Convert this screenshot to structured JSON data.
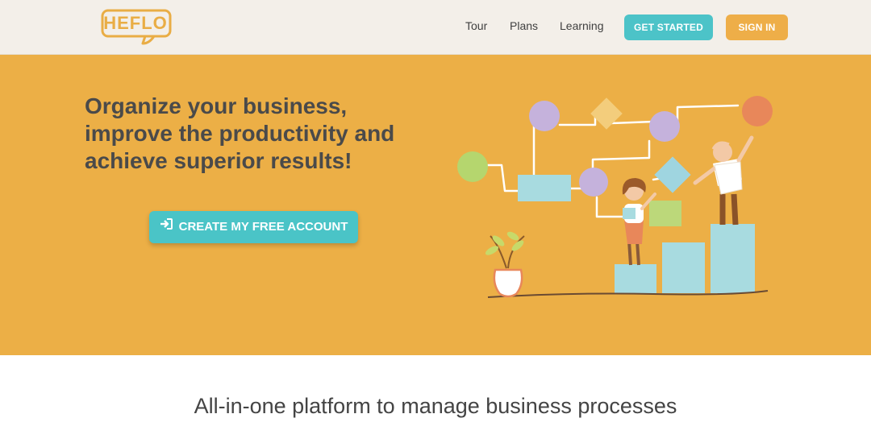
{
  "header": {
    "logo_text": "HEFLO",
    "nav": [
      "Tour",
      "Plans",
      "Learning"
    ],
    "get_started": "GET STARTED",
    "sign_in": "SIGN IN"
  },
  "hero": {
    "title_lines": [
      "Organize your business,",
      "improve the productivity and",
      "achieve superior results!"
    ],
    "cta_label": "CREATE MY FREE ACCOUNT",
    "cta_icon": "sign-in-icon"
  },
  "tagline": "All-in-one platform to manage business processes",
  "colors": {
    "hero_bg": "#ecaf46",
    "header_bg": "#f3efe9",
    "teal": "#4cc3c8",
    "orange": "#eeae48",
    "text_dark": "#4a4a4a"
  }
}
